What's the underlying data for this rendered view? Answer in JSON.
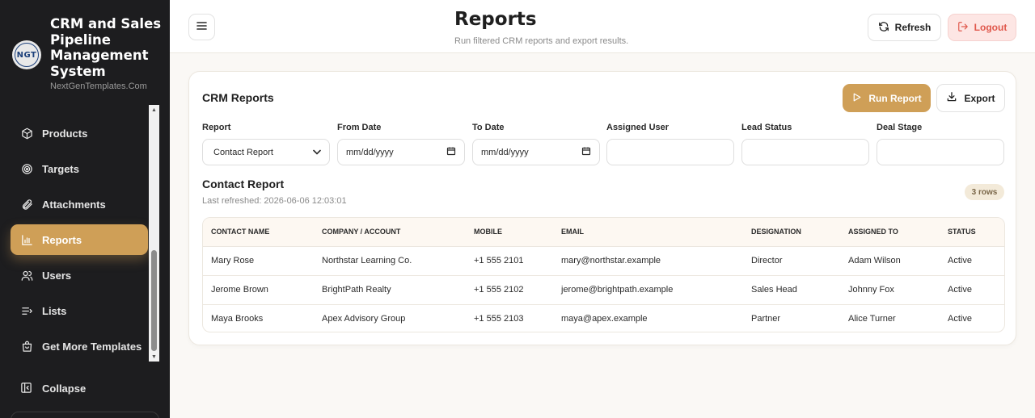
{
  "brand": {
    "logo_text": "NGT",
    "title": "CRM and Sales Pipeline Management System",
    "subtitle": "NextGenTemplates.Com"
  },
  "sidebar": {
    "items": [
      {
        "label": "Products",
        "icon": "box-icon",
        "active": false
      },
      {
        "label": "Targets",
        "icon": "target-icon",
        "active": false
      },
      {
        "label": "Attachments",
        "icon": "paperclip-icon",
        "active": false
      },
      {
        "label": "Reports",
        "icon": "bar-chart-icon",
        "active": true
      },
      {
        "label": "Users",
        "icon": "users-icon",
        "active": false
      },
      {
        "label": "Lists",
        "icon": "list-icon",
        "active": false
      },
      {
        "label": "Get More Templates",
        "icon": "shopping-bag-icon",
        "active": false
      }
    ],
    "collapse_label": "Collapse"
  },
  "header": {
    "title": "Reports",
    "subtitle": "Run filtered CRM reports and export results.",
    "refresh_label": "Refresh",
    "logout_label": "Logout"
  },
  "card": {
    "title": "CRM Reports",
    "run_label": "Run Report",
    "export_label": "Export",
    "filters": {
      "report": {
        "label": "Report",
        "value": "Contact Report"
      },
      "from_date": {
        "label": "From Date",
        "placeholder": "mm/dd/yyyy"
      },
      "to_date": {
        "label": "To Date",
        "placeholder": "mm/dd/yyyy"
      },
      "assigned_user": {
        "label": "Assigned User",
        "value": ""
      },
      "lead_status": {
        "label": "Lead Status",
        "value": ""
      },
      "deal_stage": {
        "label": "Deal Stage",
        "value": ""
      }
    }
  },
  "report": {
    "title": "Contact Report",
    "last_refreshed": "Last refreshed: 2026-06-06 12:03:01",
    "rows_badge": "3 rows",
    "columns": [
      "CONTACT NAME",
      "COMPANY / ACCOUNT",
      "MOBILE",
      "EMAIL",
      "DESIGNATION",
      "ASSIGNED TO",
      "STATUS"
    ],
    "rows": [
      [
        "Mary Rose",
        "Northstar Learning Co.",
        "+1 555 2101",
        "mary@northstar.example",
        "Director",
        "Adam Wilson",
        "Active"
      ],
      [
        "Jerome Brown",
        "BrightPath Realty",
        "+1 555 2102",
        "jerome@brightpath.example",
        "Sales Head",
        "Johnny Fox",
        "Active"
      ],
      [
        "Maya Brooks",
        "Apex Advisory Group",
        "+1 555 2103",
        "maya@apex.example",
        "Partner",
        "Alice Turner",
        "Active"
      ]
    ]
  },
  "colors": {
    "accent": "#cf9f57",
    "sidebar_bg": "#1d1d1f",
    "logout_text": "#e0584c",
    "logout_bg": "#fde6e4"
  }
}
